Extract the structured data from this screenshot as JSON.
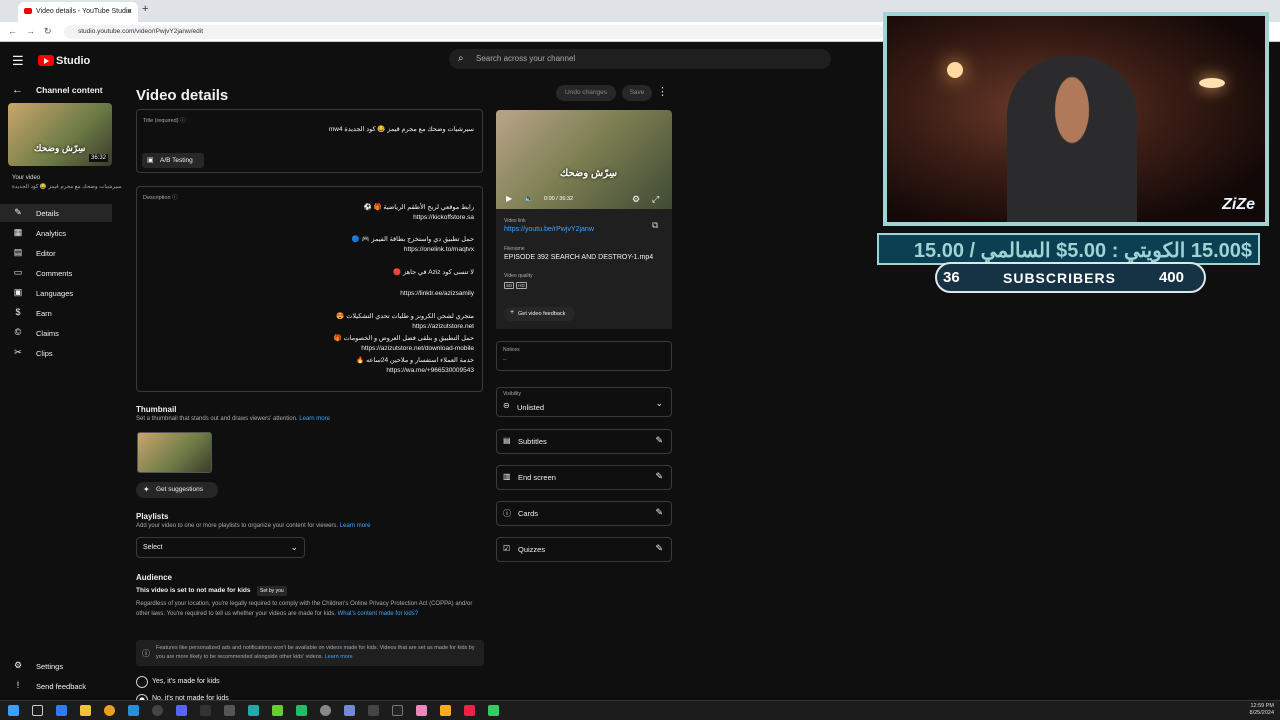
{
  "browser": {
    "tab_title": "Video details - YouTube Studio",
    "url": "studio.youtube.com/video/rPwjvY2janw/edit"
  },
  "header": {
    "logo_text": "Studio",
    "search_placeholder": "Search across your channel"
  },
  "sidebar": {
    "back_label": "Channel content",
    "thumb_duration": "36:32",
    "thumb_overlay": "سِرّش وضحك",
    "your_video_label": "Your video",
    "your_video_title": "سيرشيات وضحك مع مجرم قيمز 😂 كود الجديدة",
    "items": [
      {
        "label": "Details",
        "icon": "pencil-icon"
      },
      {
        "label": "Analytics",
        "icon": "analytics-icon"
      },
      {
        "label": "Editor",
        "icon": "editor-icon"
      },
      {
        "label": "Comments",
        "icon": "comments-icon"
      },
      {
        "label": "Languages",
        "icon": "languages-icon"
      },
      {
        "label": "Earn",
        "icon": "earn-icon"
      },
      {
        "label": "Claims",
        "icon": "claims-icon"
      },
      {
        "label": "Clips",
        "icon": "scissors-icon"
      }
    ],
    "settings": "Settings",
    "send_feedback": "Send feedback"
  },
  "main": {
    "title": "Video details",
    "undo_label": "Undo changes",
    "save_label": "Save",
    "title_field_label": "Title (required)",
    "title_value": "سيرشيات وضحك مع مجرم قيمز 😂 كود الجديدة mw4",
    "ab_testing": "A/B Testing",
    "description_label": "Description",
    "description_lines": [
      "رابط موقعي لربح الأطقم الرياضية 🎁 ⚽",
      "https://kickoffstore.sa",
      "حمل تطبيق دي واستخرج بطاقة الفيمز 🎮 🔵",
      "https://onelink.to/maqtvx",
      "لا تنسى كود Aziz في جاهز 🔴",
      "https://linktr.ee/azizsamily",
      "متجري لشحن الكرونز و طلبات تحدي التشكيلات 😍",
      "https://azizutstore.net",
      "حمل التطبيق و بتلقى فضل العروض و الخصومات 🎁",
      "https://azizutstore.net/download-mobile",
      "خدمة العملاء استفسار و ملاحين 24ساعه 🔥",
      "https://wa.me/+966530009543"
    ],
    "thumbnail_heading": "Thumbnail",
    "thumbnail_desc": "Set a thumbnail that stands out and draws viewers' attention.",
    "learn_more": "Learn more",
    "get_suggestions": "Get suggestions",
    "playlists_heading": "Playlists",
    "playlists_desc": "Add your video to one or more playlists to organize your content for viewers.",
    "playlist_select": "Select",
    "audience_heading": "Audience",
    "audience_status": "This video is set to not made for kids",
    "set_by_you": "Set by you",
    "audience_text": "Regardless of your location, you're legally required to comply with the Children's Online Privacy Protection Act (COPPA) and/or other laws. You're required to tell us whether your videos are made for kids.",
    "whats_content": "What's content made for kids?",
    "info_text": "Features like personalized ads and notifications won't be available on videos made for kids. Videos that are set as made for kids by you are more likely to be recommended alongside other kids' videos.",
    "radio_yes": "Yes, it's made for kids",
    "radio_no": "No, it's not made for kids"
  },
  "right": {
    "player_time": "0:00 / 36:32",
    "player_overlay": "سِرّش وضحك",
    "video_link_label": "Video link",
    "video_link": "https://youtu.be/rPwjvY2janw",
    "filename_label": "Filename",
    "filename": "EPISODE 392 SEARCH AND DESTROY-1.mp4",
    "quality_label": "Video quality",
    "quality_badges": [
      "SD",
      "HD"
    ],
    "feedback": "Get video feedback",
    "notices_label": "Notices",
    "notices_value": "--",
    "visibility_label": "Visibility",
    "visibility_value": "Unlisted",
    "rows": [
      {
        "label": "Subtitles",
        "icon": "subtitles-icon"
      },
      {
        "label": "End screen",
        "icon": "end-screen-icon"
      },
      {
        "label": "Cards",
        "icon": "cards-icon"
      },
      {
        "label": "Quizzes",
        "icon": "quizzes-icon"
      }
    ]
  },
  "overlay": {
    "ticker": "15.00$ الكويتي : 5.00$ السالمي / 15.00",
    "subs_left": "36",
    "subs_label": "SUBSCRIBERS",
    "subs_right": "400",
    "cam_logo": "ZiZe"
  },
  "taskbar": {
    "time": "12:59 PM",
    "date": "8/25/2024"
  }
}
